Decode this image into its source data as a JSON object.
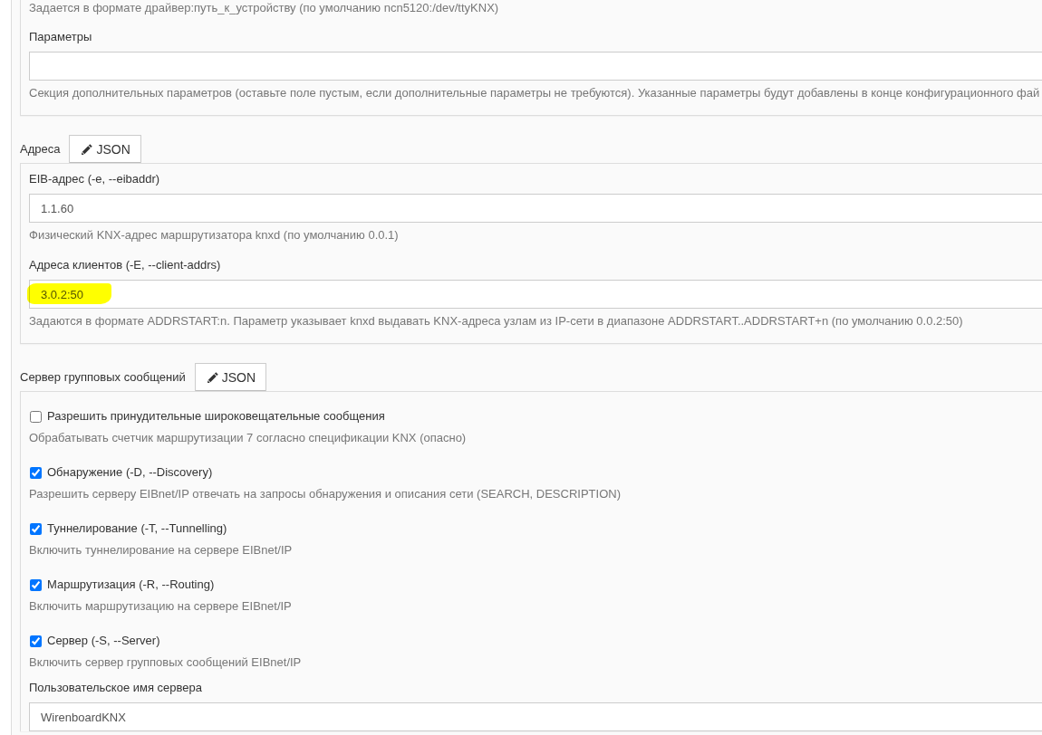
{
  "sections": [
    {
      "items": [
        {
          "kind": "note",
          "help": "Задается в формате драйвер:путь_к_устройству (по умолчанию ncn5120:/dev/ttyKNX)"
        },
        {
          "kind": "input",
          "label": "Параметры",
          "help": "Секция дополнительных параметров (оставьте поле пустым, если дополнительные параметры не требуются). Указанные параметры будут добавлены в конце конфигурационного фай"
        }
      ]
    },
    {
      "title": "Адреса",
      "button": "JSON",
      "items": [
        {
          "kind": "input",
          "label": "EIB-адрес (-e, --eibaddr)",
          "value": "1.1.60",
          "help": "Физический KNX-адрес маршрутизатора knxd (по умолчанию 0.0.1)"
        },
        {
          "kind": "input",
          "label": "Адреса клиентов (-E, --client-addrs)",
          "value": "3.0.2:50",
          "highlighted": true,
          "help": "Задаются в формате ADDRSTART:n. Параметр указывает knxd выдавать KNX-адреса узлам из IP-сети в диапазоне ADDRSTART..ADDRSTART+n (по умолчанию 0.0.2:50)"
        }
      ]
    },
    {
      "title": "Сервер групповых сообщений",
      "button": "JSON",
      "items": [
        {
          "kind": "checkbox",
          "label": "Разрешить принудительные широковещательные сообщения",
          "checked": false,
          "help": "Обрабатывать счетчик маршрутизации 7 согласно спецификации KNX (опасно)"
        },
        {
          "kind": "checkbox",
          "label": "Обнаружение (-D, --Discovery)",
          "checked": true,
          "help": "Разрешить серверу EIBnet/IP отвечать на запросы обнаружения и описания сети (SEARCH, DESCRIPTION)"
        },
        {
          "kind": "checkbox",
          "label": "Туннелирование (-T, --Tunnelling)",
          "checked": true,
          "help": "Включить туннелирование на сервере EIBnet/IP"
        },
        {
          "kind": "checkbox",
          "label": "Маршрутизация (-R, --Routing)",
          "checked": true,
          "help": "Включить маршрутизацию на сервере EIBnet/IP"
        },
        {
          "kind": "checkbox",
          "label": "Сервер (-S, --Server)",
          "checked": true,
          "help": "Включить сервер групповых сообщений EIBnet/IP"
        },
        {
          "kind": "input",
          "label": "Пользовательское имя сервера",
          "value": "WirenboardKNX"
        }
      ]
    }
  ]
}
